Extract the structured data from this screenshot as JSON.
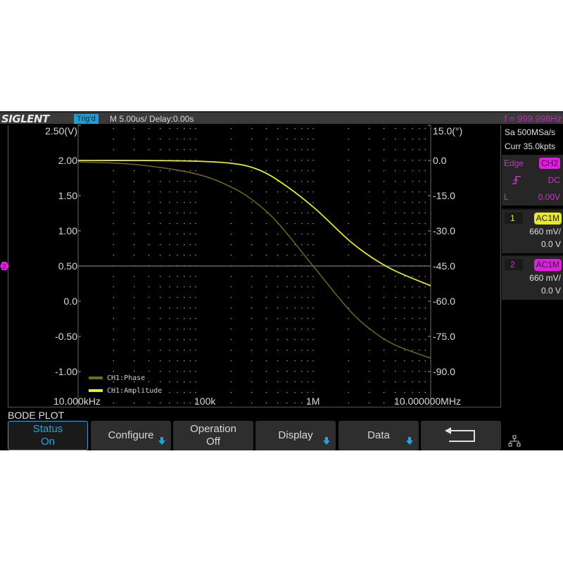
{
  "topbar": {
    "logo": "SIGLENT",
    "trigger_status": "Trig'd",
    "timebase": "M 5.00us/  Delay:0.00s",
    "frequency": "f = 999.998Hz"
  },
  "right_panel": {
    "sample_rate": "Sa 500MSa/s",
    "memory": "Curr 35.0kpts",
    "trigger": {
      "type": "Edge",
      "source": "CH2",
      "slope_icon": "rising-edge-icon",
      "coupling": "DC",
      "level_label": "L",
      "level": "0.00V"
    },
    "channels": [
      {
        "num": "1",
        "coupling": "AC1M",
        "scale": "660 mV/",
        "offset": "0.0 V",
        "color": "#e8e830"
      },
      {
        "num": "2",
        "coupling": "AC1M",
        "scale": "660 mV/",
        "offset": "0.0 V",
        "color": "#e020e0"
      }
    ]
  },
  "channel_marker": "2",
  "menu": {
    "title": "BODE PLOT",
    "softkeys": [
      {
        "line1": "Status",
        "line2": "On",
        "active": true,
        "has_arrow": false
      },
      {
        "line1": "Configure",
        "line2": "",
        "active": false,
        "has_arrow": true
      },
      {
        "line1": "Operation",
        "line2": "Off",
        "active": false,
        "has_arrow": false
      },
      {
        "line1": "Display",
        "line2": "",
        "active": false,
        "has_arrow": true
      },
      {
        "line1": "Data",
        "line2": "",
        "active": false,
        "has_arrow": true
      },
      {
        "line1": "",
        "line2": "",
        "active": false,
        "has_arrow": false,
        "icon": "return-arrow-icon"
      }
    ],
    "status_icon": "network-icon"
  },
  "chart_data": {
    "type": "line",
    "title": "Bode Plot",
    "x_scale": "log",
    "xlim": [
      10000,
      10000000
    ],
    "x_tick_labels": [
      "10.000kHz",
      "100k",
      "1M",
      "10.000000MHz"
    ],
    "x_ticks": [
      10000,
      100000,
      1000000,
      10000000
    ],
    "y_left": {
      "label": "2.50(V)",
      "ylim": [
        -1.5,
        2.5
      ],
      "ticks": [
        2.5,
        2.0,
        1.5,
        1.0,
        0.5,
        0.0,
        -0.5,
        -1.0
      ],
      "tick_labels": [
        "2.50(V)",
        "2.00",
        "1.50",
        "1.00",
        "0.50",
        "0.0",
        "-0.50",
        "-1.00"
      ]
    },
    "y_right": {
      "label": "15.0(°)",
      "ylim": [
        -105,
        15
      ],
      "ticks": [
        15,
        0,
        -15,
        -30,
        -45,
        -60,
        -75,
        -90
      ],
      "tick_labels": [
        "15.0(°)",
        "0.0",
        "-15.0",
        "-30.0",
        "-45.0",
        "-60.0",
        "-75.0",
        "-90.0"
      ]
    },
    "reference_line": {
      "left_value": 0.5,
      "right_value": -45
    },
    "grid": true,
    "legend_position": "bottom-left",
    "series": [
      {
        "name": "CH1:Phase",
        "axis": "right",
        "color": "#6e6a1e",
        "x": [
          10000,
          31623,
          100000,
          200000,
          316228,
          500000,
          1000000,
          2000000,
          3162278,
          5000000,
          10000000
        ],
        "y": [
          -0.6,
          -1.8,
          -5.7,
          -11.3,
          -17.5,
          -26.6,
          -45.0,
          -63.4,
          -72.5,
          -78.7,
          -84.3
        ]
      },
      {
        "name": "CH1:Amplitude",
        "axis": "left",
        "color": "#e8e830",
        "x": [
          10000,
          31623,
          100000,
          200000,
          316228,
          500000,
          1000000,
          2000000,
          3162278,
          5000000,
          10000000
        ],
        "y": [
          2.0,
          2.0,
          1.99,
          1.96,
          1.89,
          1.72,
          1.34,
          0.87,
          0.62,
          0.43,
          0.22
        ]
      }
    ]
  }
}
